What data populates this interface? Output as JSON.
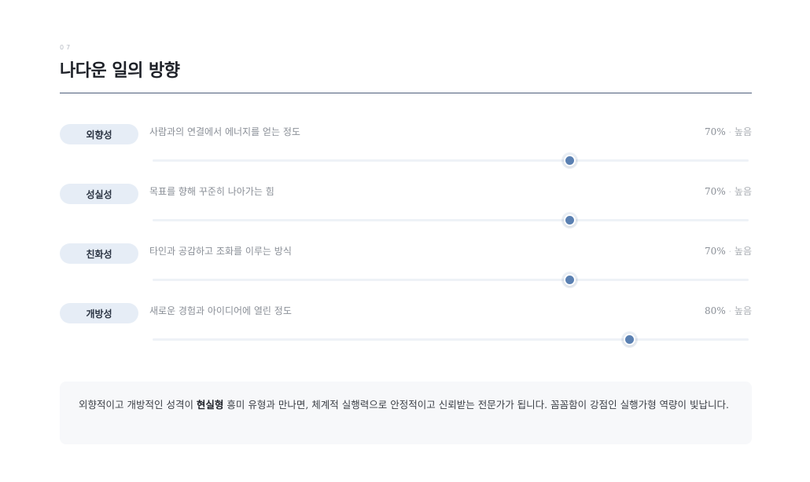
{
  "section": {
    "number": "07",
    "title": "나다운 일의 방향"
  },
  "traits": [
    {
      "name": "외향성",
      "description": "사람과의 연결에서 에너지를 얻는 정도",
      "percent_label": "70%",
      "level": "높음",
      "value": 0.7
    },
    {
      "name": "성실성",
      "description": "목표를 향해 꾸준히 나아가는 힘",
      "percent_label": "70%",
      "level": "높음",
      "value": 0.7
    },
    {
      "name": "친화성",
      "description": "타인과 공감하고 조화를 이루는 방식",
      "percent_label": "70%",
      "level": "높음",
      "value": 0.7
    },
    {
      "name": "개방성",
      "description": "새로운 경험과 아이디어에 열린 정도",
      "percent_label": "80%",
      "level": "높음",
      "value": 0.8
    }
  ],
  "summary": {
    "before": "외향적이고 개방적인 성격이 ",
    "highlight": "현실형",
    "after": " 흥미 유형과 만나면, 체계적 실행력으로 안정적이고 신뢰받는 전문가가 됩니다. 꼼꼼함이 강점인 실행가형 역량이 빛납니다."
  },
  "colors": {
    "accent": "#5a80b2",
    "pill_bg": "#e6edf6",
    "rule": "#4d5d7a",
    "summary_bg": "#f7f8fa"
  }
}
